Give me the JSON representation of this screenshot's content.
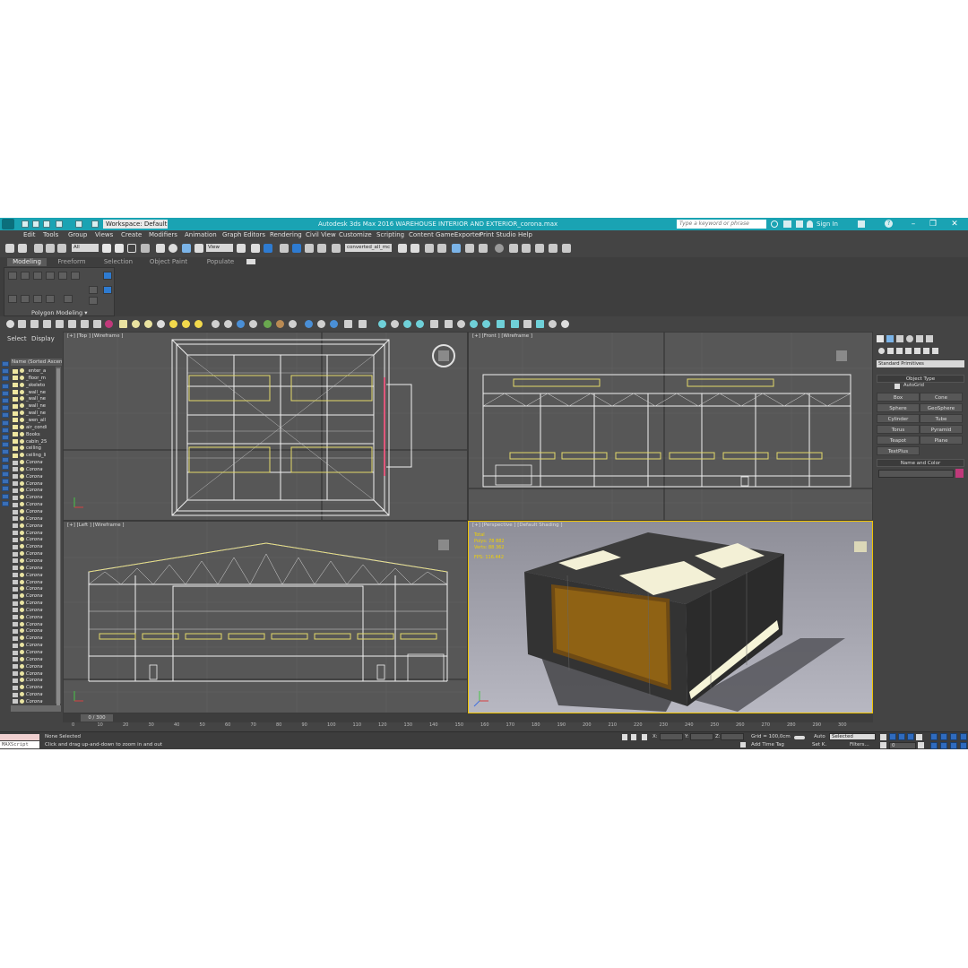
{
  "title_bar": {
    "workspace_label": "Workspace: Default",
    "title_text": "Autodesk 3ds Max 2016    WAREHOUSE INTERIOR AND EXTERIOR_corona.max",
    "search_placeholder": "Type a keyword or phrase",
    "sign_in": "Sign In"
  },
  "menu": [
    "Edit",
    "Tools",
    "Group",
    "Views",
    "Create",
    "Modifiers",
    "Animation",
    "Graph Editors",
    "Rendering",
    "Civil View",
    "Customize",
    "Scripting",
    "Content",
    "GameExporter",
    "Print Studio",
    "Help"
  ],
  "toolbar": {
    "selection_filter": "All",
    "ref_coord": "View",
    "named_selection": "converted_all_mc"
  },
  "ribbon": {
    "tabs": [
      "Modeling",
      "Freeform",
      "Selection",
      "Object Paint",
      "Populate"
    ],
    "active_tab": "Modeling",
    "panel_label": "Polygon Modeling ▾"
  },
  "scene_explorer": {
    "tabs": [
      "Select",
      "Display"
    ],
    "column_header": "Name (Sorted Ascen",
    "rows": [
      "_enter_a",
      "_floor_m",
      "_skeleto",
      "_wall_ne",
      "_wall_ne",
      "_wall_ne",
      "_wall_ne",
      "_wen_all",
      "air_condi",
      "Books",
      "cabin_25",
      "ceiling",
      "ceiling_li",
      "Corona",
      "Corona",
      "Corona",
      "Corona",
      "Corona",
      "Corona",
      "Corona",
      "Corona",
      "Corona",
      "Corona",
      "Corona",
      "Corona",
      "Corona",
      "Corona",
      "Corona",
      "Corona",
      "Corona",
      "Corona",
      "Corona",
      "Corona",
      "Corona",
      "Corona",
      "Corona",
      "Corona",
      "Corona",
      "Corona",
      "Corona",
      "Corona",
      "Corona",
      "Corona",
      "Corona",
      "Corona",
      "Corona",
      "Corona",
      "Corona"
    ]
  },
  "viewports": {
    "top": "[+] [Top ] [Wireframe ]",
    "front": "[+] [Front ] [Wireframe ]",
    "left": "[+] [Left ] [Wireframe ]",
    "perspective": "[+] [Perspective ] [Default Shading ]",
    "stats": [
      "Total",
      "Polys:  78 882",
      "Verts:  88 362",
      "FPS:    116.442"
    ]
  },
  "command_panel": {
    "category": "Standard Primitives",
    "object_type_header": "Object Type",
    "autogrid": "AutoGrid",
    "buttons": [
      "Box",
      "Cone",
      "Sphere",
      "GeoSphere",
      "Cylinder",
      "Tube",
      "Torus",
      "Pyramid",
      "Teapot",
      "Plane",
      "TextPlus"
    ],
    "name_color_header": "Name and Color",
    "color": "#c0397a"
  },
  "timeline": {
    "frame_label": "0 / 300",
    "ticks": [
      "0",
      "10",
      "20",
      "30",
      "40",
      "50",
      "60",
      "70",
      "80",
      "90",
      "100",
      "110",
      "120",
      "130",
      "140",
      "150",
      "160",
      "170",
      "180",
      "190",
      "200",
      "210",
      "220",
      "230",
      "240",
      "250",
      "260",
      "270",
      "280",
      "290",
      "300"
    ]
  },
  "status": {
    "maxscript": "MAXScript",
    "selection": "None Selected",
    "prompt": "Click and drag up-and-down to zoom in and out",
    "x_label": "X:",
    "y_label": "Y:",
    "z_label": "Z:",
    "grid": "Grid = 100,0cm",
    "add_time_tag": "Add Time Tag",
    "auto": "Auto",
    "set_k": "Set K.",
    "selected_dd": "Selected",
    "filters": "Filters...",
    "frame_value": "0"
  }
}
